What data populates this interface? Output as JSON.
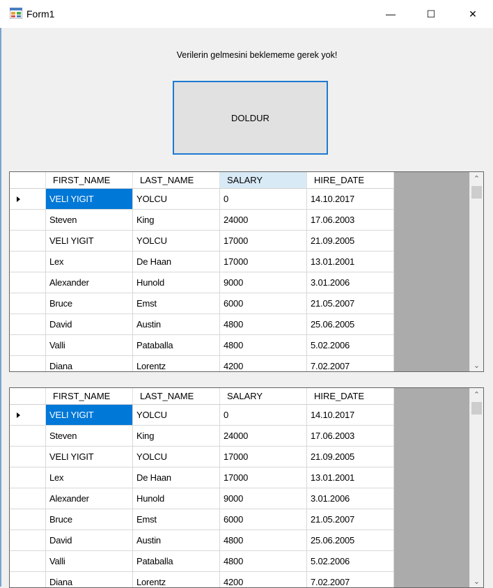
{
  "window": {
    "title": "Form1",
    "minimize": "—",
    "maximize": "☐",
    "close": "✕"
  },
  "message": "Verilerin gelmesini beklememe gerek yok!",
  "fill_button": "DOLDUR",
  "columns": [
    "FIRST_NAME",
    "LAST_NAME",
    "SALARY",
    "HIRE_DATE"
  ],
  "scroll": {
    "up": "⌃",
    "down": "⌄"
  },
  "grids": [
    {
      "rows": [
        [
          "VELI YIGIT",
          "YOLCU",
          "0",
          "14.10.2017"
        ],
        [
          "Steven",
          "King",
          "24000",
          "17.06.2003"
        ],
        [
          "VELI YIGIT",
          "YOLCU",
          "17000",
          "21.09.2005"
        ],
        [
          "Lex",
          "De Haan",
          "17000",
          "13.01.2001"
        ],
        [
          "Alexander",
          "Hunold",
          "9000",
          "3.01.2006"
        ],
        [
          "Bruce",
          "Emst",
          "6000",
          "21.05.2007"
        ],
        [
          "David",
          "Austin",
          "4800",
          "25.06.2005"
        ],
        [
          "Valli",
          "Pataballa",
          "4800",
          "5.02.2006"
        ],
        [
          "Diana",
          "Lorentz",
          "4200",
          "7.02.2007"
        ]
      ]
    },
    {
      "rows": [
        [
          "VELI YIGIT",
          "YOLCU",
          "0",
          "14.10.2017"
        ],
        [
          "Steven",
          "King",
          "24000",
          "17.06.2003"
        ],
        [
          "VELI YIGIT",
          "YOLCU",
          "17000",
          "21.09.2005"
        ],
        [
          "Lex",
          "De Haan",
          "17000",
          "13.01.2001"
        ],
        [
          "Alexander",
          "Hunold",
          "9000",
          "3.01.2006"
        ],
        [
          "Bruce",
          "Emst",
          "6000",
          "21.05.2007"
        ],
        [
          "David",
          "Austin",
          "4800",
          "25.06.2005"
        ],
        [
          "Valli",
          "Pataballa",
          "4800",
          "5.02.2006"
        ],
        [
          "Diana",
          "Lorentz",
          "4200",
          "7.02.2007"
        ]
      ]
    }
  ]
}
